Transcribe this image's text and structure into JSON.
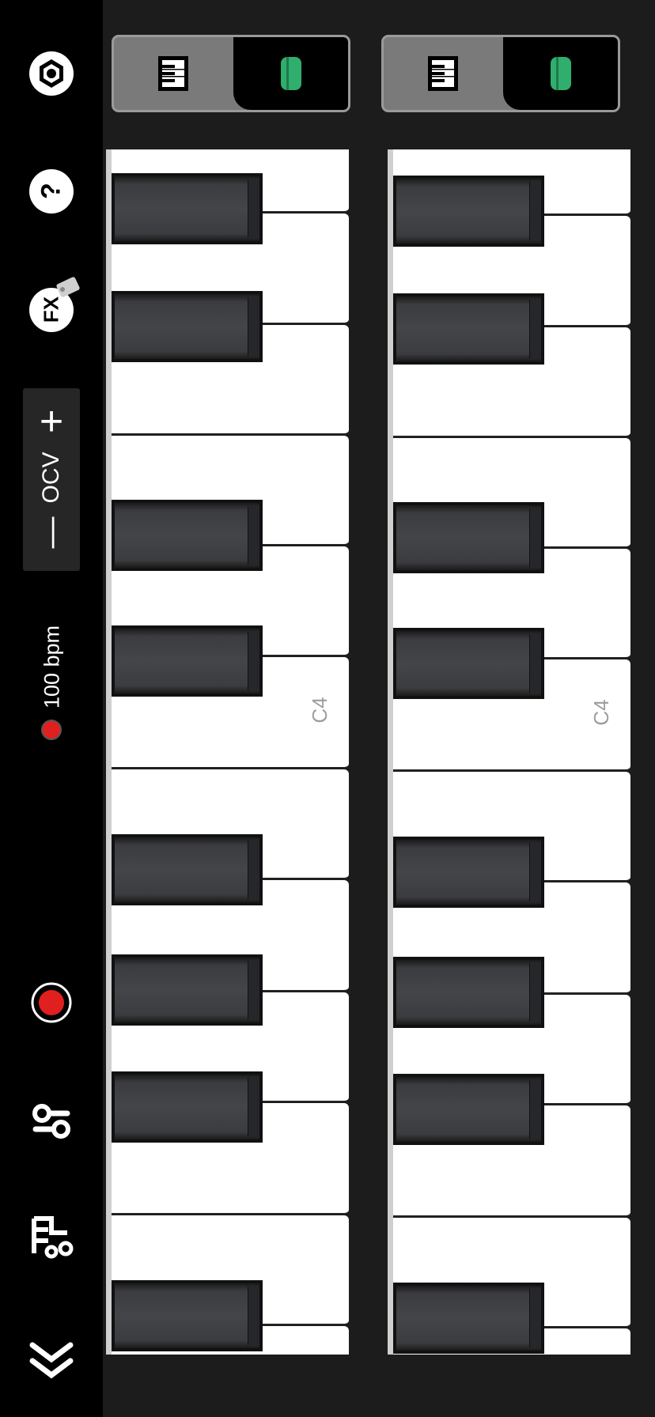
{
  "sidebar": {
    "settings_icon": "settings-hexagon-icon",
    "help_icon": "help-icon",
    "help_label": "?",
    "fx_label": "FX",
    "fx_icon": "tag-icon",
    "octave": {
      "label": "OCV",
      "minus": "—",
      "plus": "+"
    },
    "tempo": {
      "indicator_color": "#e0201f",
      "text": "100 bpm"
    },
    "record_icon": "record-icon",
    "mixer_icon": "mixer-icon",
    "library_icon": "library-icon",
    "collapse_icon": "double-chevron-icon"
  },
  "keyboards": [
    {
      "mode_toggle": {
        "piano_icon": "piano-icon",
        "drum_icon": "drum-pad-icon",
        "accent": "#2fae6e"
      },
      "c_label": "C4"
    },
    {
      "mode_toggle": {
        "piano_icon": "piano-icon",
        "drum_icon": "drum-pad-icon",
        "accent": "#2fae6e"
      },
      "c_label": "C4"
    }
  ]
}
